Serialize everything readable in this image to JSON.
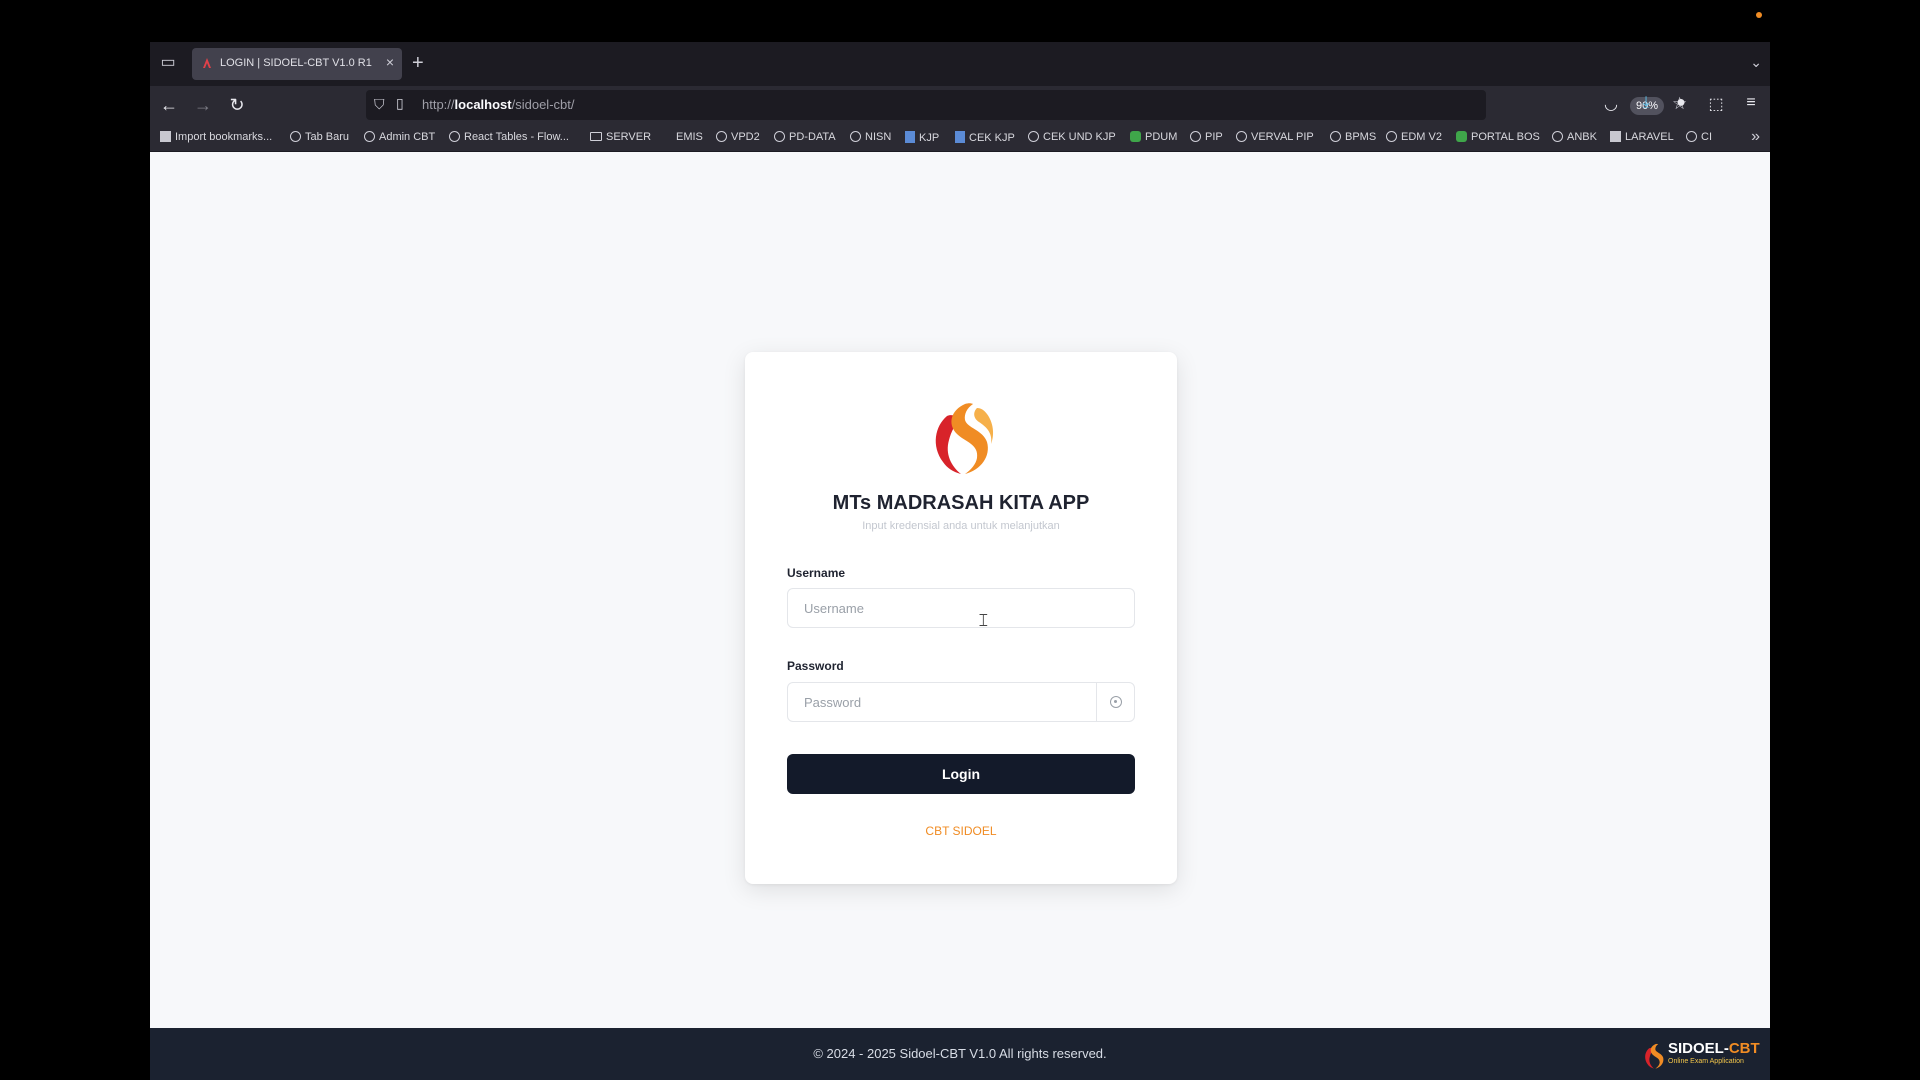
{
  "tab": {
    "title": "LOGIN | SIDOEL-CBT V1.0 R1",
    "close": "×",
    "new": "+"
  },
  "nav": {
    "back": "←",
    "forward": "→",
    "reload": "↻",
    "url_scheme": "http://",
    "url_host": "localhost",
    "url_path": "/sidoel-cbt/",
    "zoom": "90%"
  },
  "bookmarks": [
    "Import bookmarks...",
    "Tab Baru",
    "Admin CBT",
    "React Tables - Flow...",
    "SERVER",
    "EMIS",
    "VPD2",
    "PD-DATA",
    "NISN",
    "KJP",
    "CEK KJP",
    "CEK UND KJP",
    "PDUM",
    "PIP",
    "VERVAL PIP",
    "BPMS",
    "EDM V2",
    "PORTAL BOS",
    "ANBK",
    "LARAVEL",
    "CI"
  ],
  "login": {
    "app_title": "MTs MADRASAH KITA APP",
    "subtitle": "Input kredensial anda untuk melanjutkan",
    "username_label": "Username",
    "username_placeholder": "Username",
    "password_label": "Password",
    "password_placeholder": "Password",
    "login_button": "Login",
    "footer_link": "CBT SIDOEL"
  },
  "footer": {
    "copyright": "© 2024 - 2025 Sidoel-CBT V1.0 All rights reserved.",
    "watermark_main": "SIDOEL-",
    "watermark_accent": "CBT",
    "watermark_sub": "Online Exam Application"
  },
  "colors": {
    "accent": "#f08c24",
    "logo_red": "#d8232a",
    "button_dark": "#131a2a",
    "footer_bg": "#1b2230"
  },
  "icons": [
    "tab-list-icon",
    "close-icon",
    "plus-icon",
    "back-icon",
    "forward-icon",
    "reload-icon",
    "shield-icon",
    "page-icon",
    "star-icon",
    "pocket-icon",
    "download-icon",
    "account-icon",
    "extensions-icon",
    "menu-icon",
    "globe-icon",
    "folder-icon",
    "eye-icon",
    "chevron-double-right-icon"
  ]
}
